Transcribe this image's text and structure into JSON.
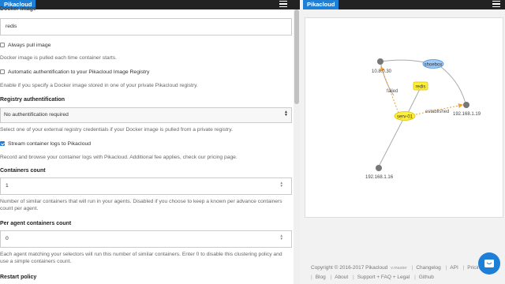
{
  "left": {
    "brand": "Pikacloud",
    "cut_label": "Docker image",
    "image_value": "redis",
    "always_pull": {
      "label": "Always pull image",
      "checked": false,
      "hint": "Docker image is pulled each time container starts."
    },
    "auto_auth": {
      "label": "Automatic authentification to your Pikacloud Image Registry",
      "checked": false,
      "hint": "Enable if you specify a Docker image stored in one of your private Pikacloud registry."
    },
    "registry": {
      "label": "Registry authentification",
      "selected": "No authentification required",
      "hint": "Select one of your external registry credentials if your Docker image is pulled from a private registry."
    },
    "stream": {
      "label": "Stream container logs to Pikacloud",
      "checked": true,
      "hint": "Record and browse your container logs with Pikacloud. Additional fee applies, check our pricing page."
    },
    "containers_count": {
      "label": "Containers count",
      "value": "1",
      "hint": "Number of similar containers that will run in your agents. Disabled if you choose to keep a known per advance containers count per agent."
    },
    "per_agent": {
      "label": "Per agent containers count",
      "value": "0",
      "hint": "Each agent matching your selectors will run this number of similar containers. Enter 0 to disable this clustering policy and use a simple containers count."
    },
    "restart": {
      "label": "Restart policy"
    }
  },
  "right": {
    "brand": "Pikacloud",
    "graph": {
      "nodes": [
        {
          "id": "n1",
          "label": "10.8.0.30",
          "kind": "host"
        },
        {
          "id": "n2",
          "label": "192.168.1.19",
          "kind": "host"
        },
        {
          "id": "n3",
          "label": "192.168.1.16",
          "kind": "host"
        },
        {
          "id": "shoebox",
          "label": "shoebox",
          "kind": "tag-blue"
        },
        {
          "id": "redis",
          "label": "redis",
          "kind": "tag-yellow"
        },
        {
          "id": "serv01",
          "label": "serv-01",
          "kind": "tag-yellow-ellipse"
        }
      ],
      "edges": [
        {
          "label": "failed"
        },
        {
          "label": "established"
        }
      ],
      "colors": {
        "host": "#777777",
        "edge": "#aaaaaa",
        "active": "#f0a030",
        "yellow": "#ffef3a",
        "blue": "#9cc9f5"
      }
    },
    "footer": {
      "copyright": "Copyright © 2016-2017 Pikacloud",
      "version": "v.master",
      "links_row1": [
        "Changelog",
        "API",
        "Pricin"
      ],
      "links_row2": [
        "Blog",
        "About",
        "Support + FAQ + Legal",
        "Github"
      ]
    }
  }
}
